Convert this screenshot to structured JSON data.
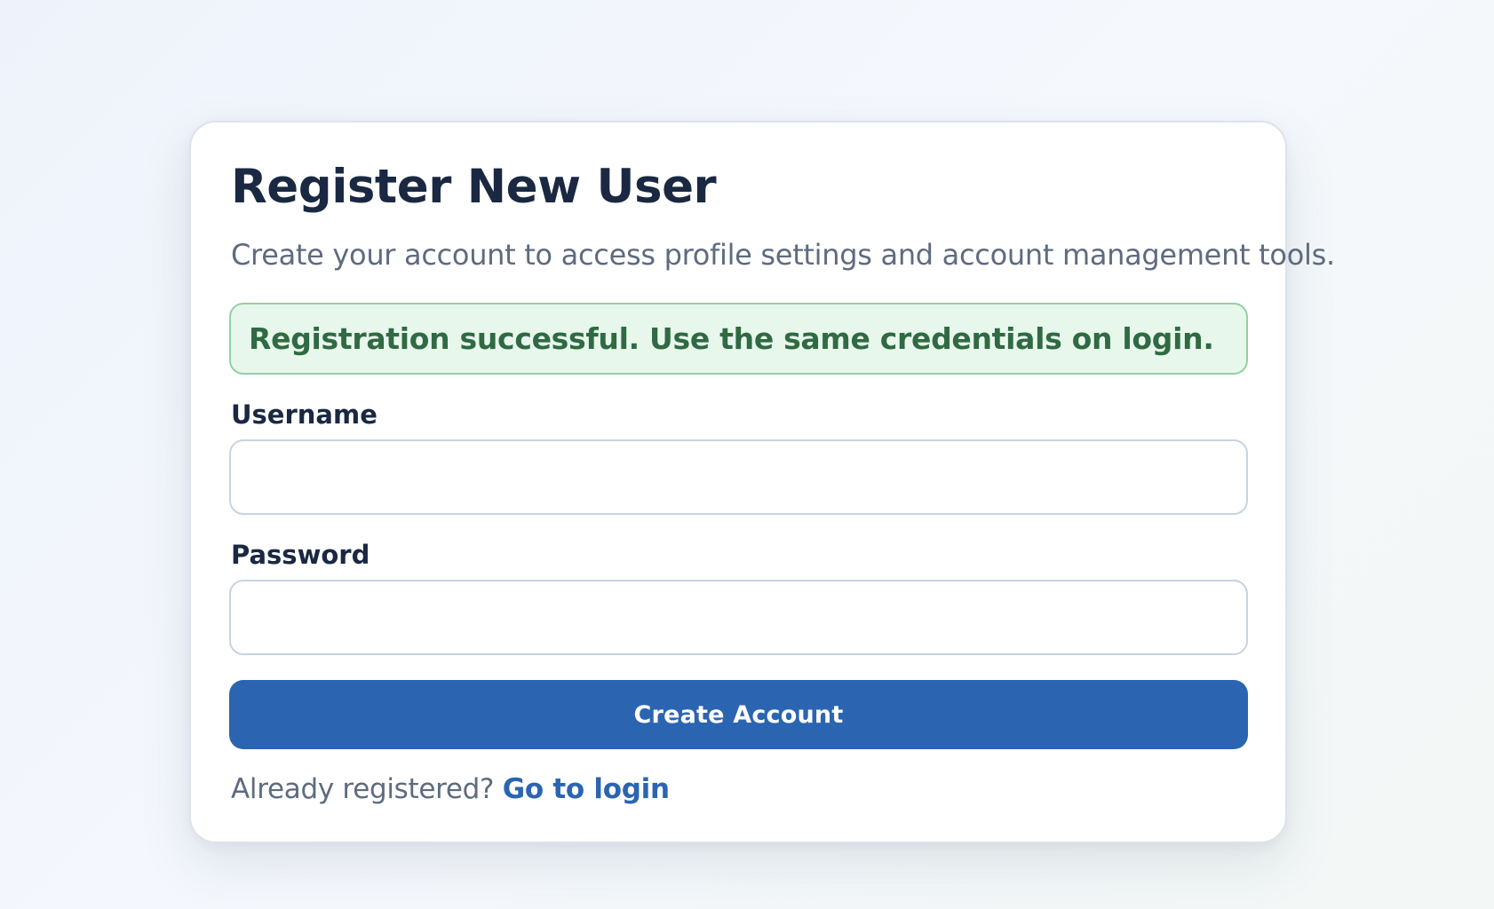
{
  "card": {
    "title": "Register New User",
    "subtitle": "Create your account to access profile settings and account management tools."
  },
  "alert": {
    "message": "Registration successful. Use the same credentials on login."
  },
  "form": {
    "username_label": "Username",
    "username_value": "",
    "password_label": "Password",
    "password_value": "",
    "submit_label": "Create Account"
  },
  "footer": {
    "prompt": "Already registered?",
    "link_label": "Go to login"
  },
  "colors": {
    "primary": "#2b65b1",
    "heading": "#1a2842",
    "muted": "#5e6b7f",
    "success_bg": "#e8f7ec",
    "success_border": "#92d1a4",
    "success_text": "#2f6a42"
  }
}
